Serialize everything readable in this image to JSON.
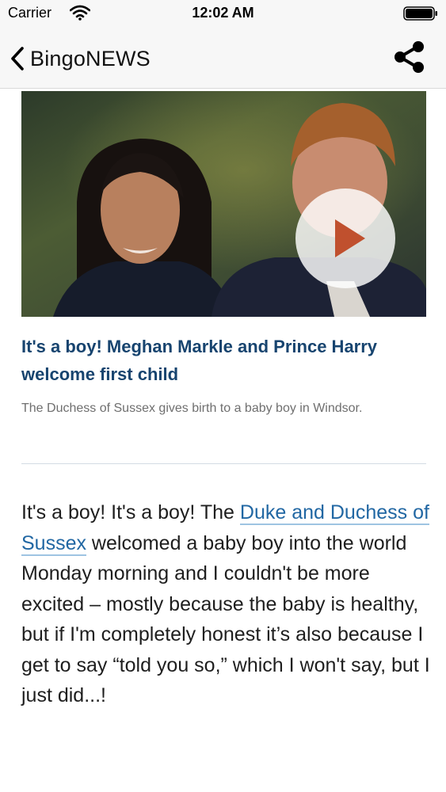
{
  "status_bar": {
    "carrier": "Carrier",
    "time": "12:02 AM"
  },
  "nav": {
    "title": "BingoNEWS",
    "back_icon": "chevron-left-icon",
    "share_icon": "share-icon"
  },
  "hero": {
    "has_video": true,
    "play_icon": "play-icon"
  },
  "article": {
    "headline": "It's a boy! Meghan Markle and Prince Harry welcome first child",
    "summary": "The Duchess of Sussex gives birth to a baby boy in Windsor.",
    "body_before_link": "It's a boy! It's a boy! The ",
    "body_link": "Duke and Duchess of Sussex",
    "body_after_link": " welcomed a baby boy into the world Monday morning and I couldn't be more excited – mostly because the baby is healthy, but if I'm completely honest it’s also because I get to say “told you so,” which I won't say, but I just did...!"
  },
  "colors": {
    "headline": "#17446f",
    "link": "#2167a3",
    "summary": "#6f6f6f",
    "play_arrow": "#c0502e"
  }
}
